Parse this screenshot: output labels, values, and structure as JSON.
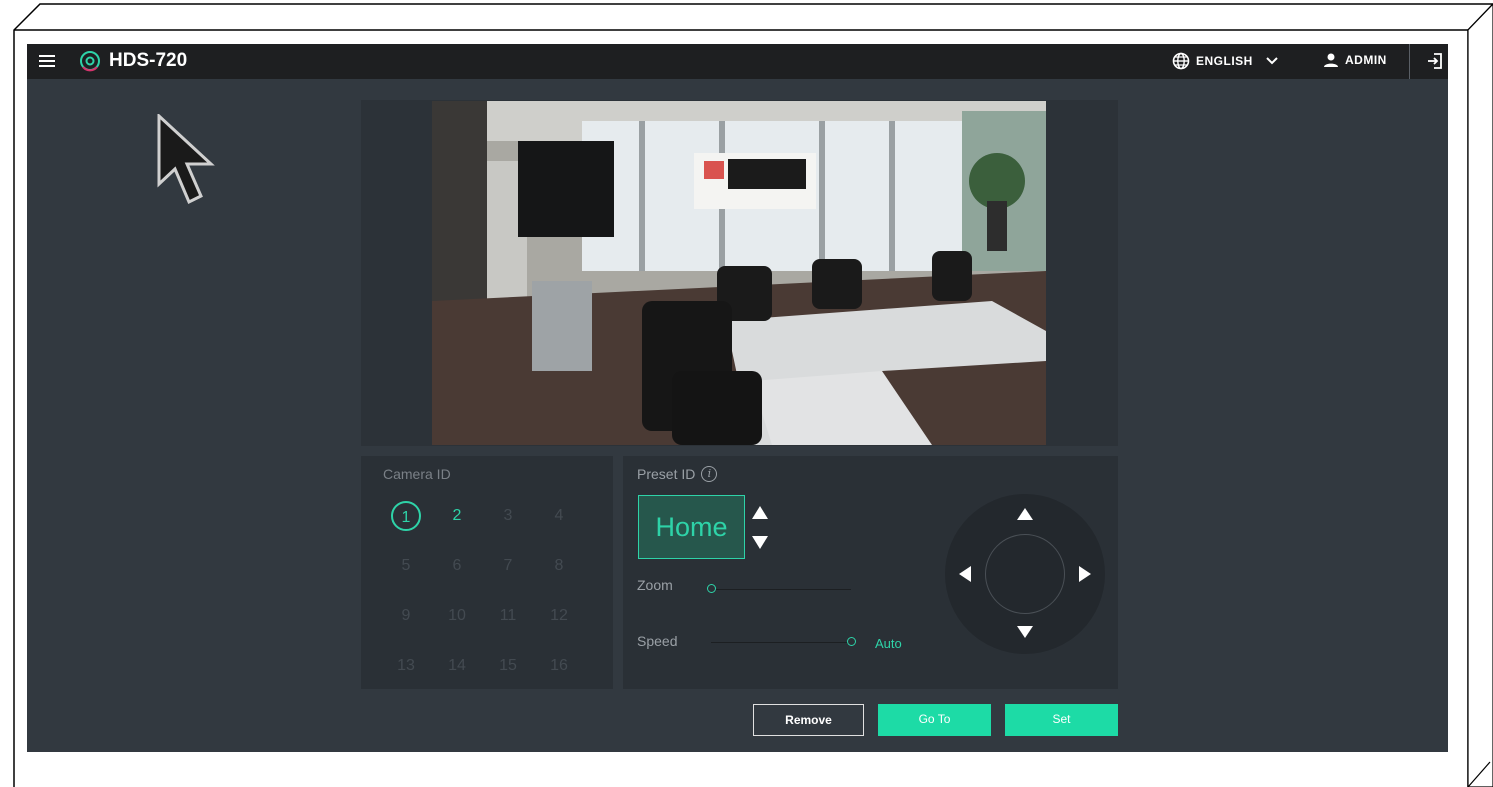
{
  "header": {
    "title": "HDS-720",
    "language_label": "ENGLISH",
    "user_label": "ADMIN"
  },
  "camera": {
    "title": "Camera ID",
    "ids": [
      "1",
      "2",
      "3",
      "4",
      "5",
      "6",
      "7",
      "8",
      "9",
      "10",
      "11",
      "12",
      "13",
      "14",
      "15",
      "16"
    ],
    "selected": "1",
    "available": [
      "2"
    ]
  },
  "preset": {
    "title": "Preset ID",
    "value": "Home",
    "zoom_label": "Zoom",
    "speed_label": "Speed",
    "speed_mode": "Auto",
    "zoom_level": 0,
    "speed_level": 1
  },
  "actions": {
    "remove_label": "Remove",
    "goto_label": "Go To",
    "set_label": "Set"
  },
  "colors": {
    "accent": "#2ed3a8",
    "button": "#1ddba6",
    "background": "#323940",
    "topbar": "#1e1f21"
  },
  "icons": [
    "menu-icon",
    "logo-icon",
    "globe-icon",
    "chevron-down-icon",
    "user-icon",
    "logout-icon",
    "info-icon",
    "arrow-up-icon",
    "arrow-down-icon",
    "arrow-left-icon",
    "arrow-right-icon",
    "mouse-cursor-icon"
  ]
}
